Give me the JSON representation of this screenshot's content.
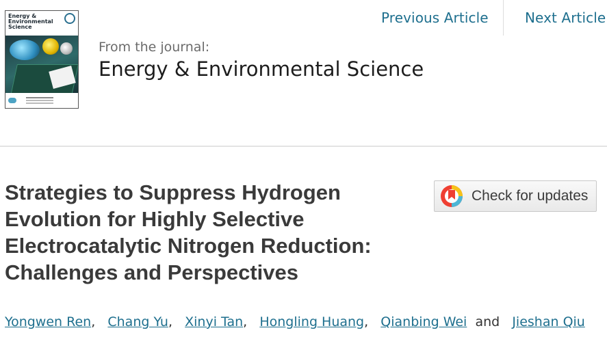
{
  "nav": {
    "previous_label": "Previous Article",
    "next_label": "Next Article"
  },
  "journal": {
    "from_label": "From the journal:",
    "name": "Energy & Environmental Science",
    "cover_title": "Energy & Environmental Science"
  },
  "article": {
    "title": "Strategies to Suppress Hydrogen Evolution for Highly Selective Electrocatalytic Nitrogen Reduction: Challenges and Perspectives",
    "check_updates_label": "Check for updates",
    "authors": [
      "Yongwen Ren",
      "Chang Yu",
      "Xinyi Tan",
      "Hongling Huang",
      "Qianbing Wei",
      "Jieshan Qiu"
    ],
    "authors_joiner": "and"
  },
  "colors": {
    "link": "#1e6f8e",
    "title_text": "#3a3a3a"
  }
}
